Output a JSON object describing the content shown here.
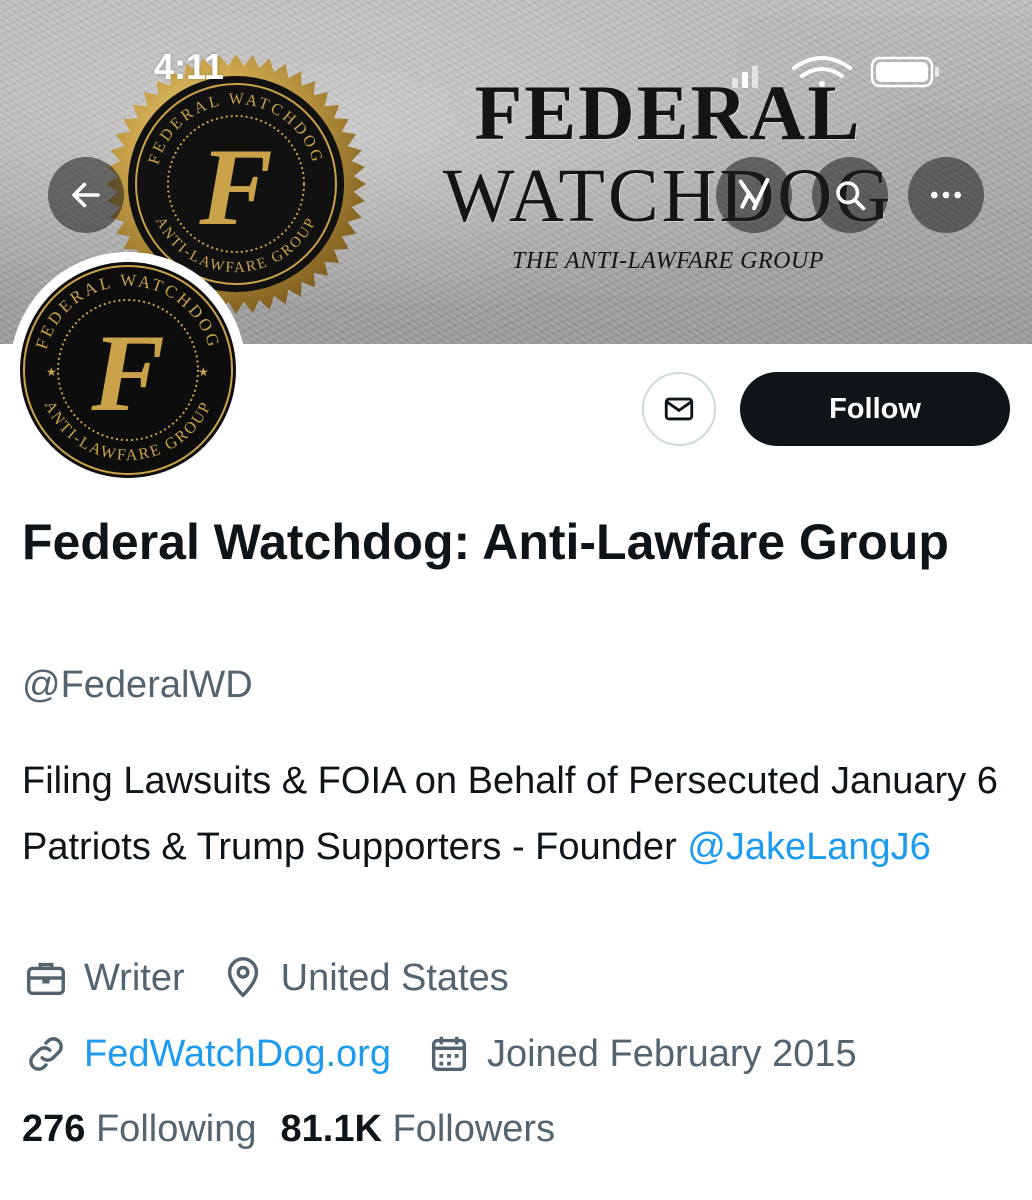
{
  "status_bar": {
    "time": "4:11"
  },
  "banner": {
    "title_line1": "FEDERAL",
    "title_line2": "WATCHDOG",
    "subtitle": "THE ANTI-LAWFARE GROUP",
    "seal_text_top": "FEDERAL WATCHDOG",
    "seal_text_bottom": "ANTI-LAWFARE GROUP",
    "seal_letter": "F"
  },
  "nav": {
    "back_icon": "arrow-left-icon",
    "grok_icon": "grok-icon",
    "search_icon": "search-icon",
    "more_icon": "more-icon"
  },
  "actions": {
    "message_icon": "envelope-icon",
    "follow_label": "Follow"
  },
  "profile": {
    "display_name": "Federal Watchdog: Anti-Lawfare Group",
    "handle": "@FederalWD",
    "bio_text": "Filing Lawsuits & FOIA on Behalf of Persecuted January 6 Patriots & Trump Supporters - Founder ",
    "bio_mention": "@JakeLangJ6",
    "category": "Writer",
    "location": "United States",
    "website": "FedWatchDog.org",
    "joined": "Joined February 2015",
    "following_count": "276",
    "following_label": "Following",
    "followers_count": "81.1K",
    "followers_label": "Followers"
  },
  "colors": {
    "accent": "#1d9bf0",
    "text": "#0f1419",
    "secondary": "#536471",
    "seal_gold": "#c9a24a"
  }
}
